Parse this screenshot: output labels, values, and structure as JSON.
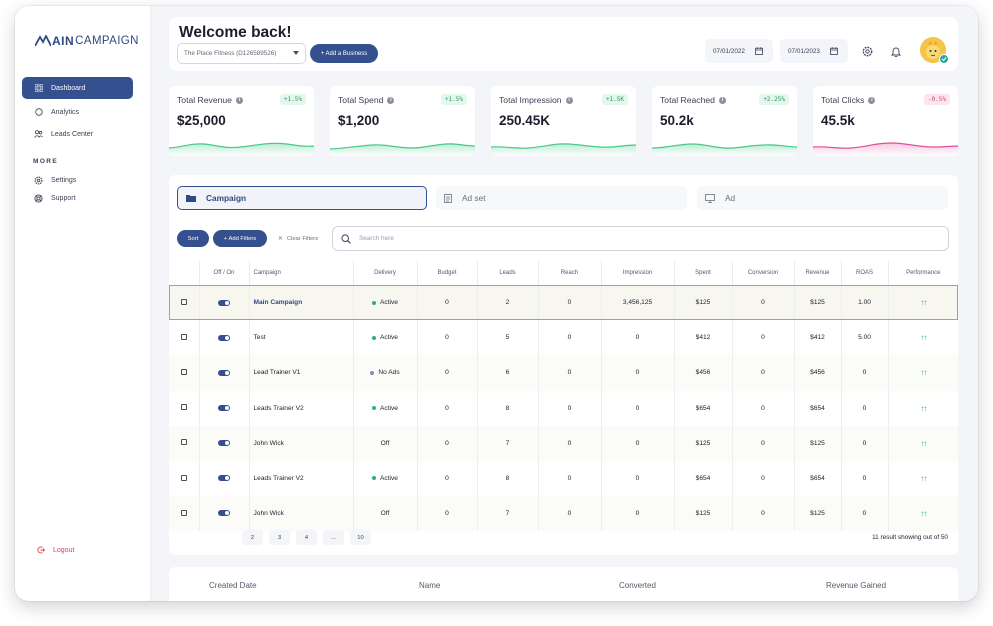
{
  "sidebar": {
    "logo_part1": "AIN",
    "logo_part2": "CAMPAIGN",
    "items": [
      {
        "label": "Dashboard"
      },
      {
        "label": "Analytics"
      },
      {
        "label": "Leads Center"
      }
    ],
    "more_label": "MORE",
    "more_items": [
      {
        "label": "Settings"
      },
      {
        "label": "Support"
      }
    ],
    "logout": "Logout"
  },
  "header": {
    "welcome": "Welcome back!",
    "business": "The Place Fitness (D126589526)",
    "add_business": "+ Add a Business",
    "date_from": "07/01/2022",
    "date_to": "07/01/2023"
  },
  "stats": [
    {
      "label": "Total Revenue",
      "value": "$25,000",
      "change": "+1.5%",
      "trend": "up",
      "color": "#47c989"
    },
    {
      "label": "Total Spend",
      "value": "$1,200",
      "change": "+1.5%",
      "trend": "up",
      "color": "#47c989"
    },
    {
      "label": "Total Impression",
      "value": "250.45K",
      "change": "+1.5K",
      "trend": "up",
      "color": "#47c989"
    },
    {
      "label": "Total Reached",
      "value": "50.2k",
      "change": "+2.25%",
      "trend": "up",
      "color": "#47c989"
    },
    {
      "label": "Total Clicks",
      "value": "45.5k",
      "change": "-0.5%",
      "trend": "down",
      "color": "#e04f9a"
    }
  ],
  "tabs": {
    "campaign": "Campaign",
    "adset": "Ad set",
    "ad": "Ad"
  },
  "toolbar": {
    "sort": "Sort",
    "add_filters": "+ Add Filters",
    "clear_filters": "Clear Filters",
    "search_placeholder": "Search here"
  },
  "table": {
    "columns": [
      "",
      "Off / On",
      "Campaign",
      "Delivery",
      "Budget",
      "Leads",
      "Reach",
      "Impression",
      "Spent",
      "Conversion",
      "Revenue",
      "ROAS",
      "Performance"
    ],
    "rows": [
      {
        "campaign": "Main Campaign",
        "delivery": "Active",
        "delivery_status": "active",
        "budget": "0",
        "leads": "2",
        "reach": "0",
        "impression": "3,456,125",
        "spent": "$125",
        "conversion": "0",
        "revenue": "$125",
        "roas": "1.00",
        "performance": "↑↑"
      },
      {
        "campaign": "Test",
        "delivery": "Active",
        "delivery_status": "active",
        "budget": "0",
        "leads": "5",
        "reach": "0",
        "impression": "0",
        "spent": "$412",
        "conversion": "0",
        "revenue": "$412",
        "roas": "5.00",
        "performance": "↑↑"
      },
      {
        "campaign": "Lead Trainer V1",
        "delivery": "No Ads",
        "delivery_status": "noads",
        "budget": "0",
        "leads": "6",
        "reach": "0",
        "impression": "0",
        "spent": "$456",
        "conversion": "0",
        "revenue": "$456",
        "roas": "0",
        "performance": "↑↑"
      },
      {
        "campaign": "Leads Trainer V2",
        "delivery": "Active",
        "delivery_status": "active",
        "budget": "0",
        "leads": "8",
        "reach": "0",
        "impression": "0",
        "spent": "$654",
        "conversion": "0",
        "revenue": "$654",
        "roas": "0",
        "performance": "↑↑"
      },
      {
        "campaign": "John Wick",
        "delivery": "Off",
        "delivery_status": "off",
        "budget": "0",
        "leads": "7",
        "reach": "0",
        "impression": "0",
        "spent": "$125",
        "conversion": "0",
        "revenue": "$125",
        "roas": "0",
        "performance": "↑↑"
      },
      {
        "campaign": "Leads Trainer V2",
        "delivery": "Active",
        "delivery_status": "active",
        "budget": "0",
        "leads": "8",
        "reach": "0",
        "impression": "0",
        "spent": "$654",
        "conversion": "0",
        "revenue": "$654",
        "roas": "0",
        "performance": "↑↑"
      },
      {
        "campaign": "John Wick",
        "delivery": "Off",
        "delivery_status": "off",
        "budget": "0",
        "leads": "7",
        "reach": "0",
        "impression": "0",
        "spent": "$125",
        "conversion": "0",
        "revenue": "$125",
        "roas": "0",
        "performance": "↑↑"
      }
    ]
  },
  "pagination": {
    "pages": [
      "2",
      "3",
      "4",
      "...",
      "10"
    ],
    "result_text": "11 result showing out of 50"
  },
  "bottom_table": {
    "columns": [
      "Created Date",
      "Name",
      "Converted",
      "Revenue Gained"
    ]
  },
  "colors": {
    "brand": "#34508f",
    "positive": "#2fb06b",
    "negative": "#e04f9a",
    "logout": "#e0414a"
  }
}
